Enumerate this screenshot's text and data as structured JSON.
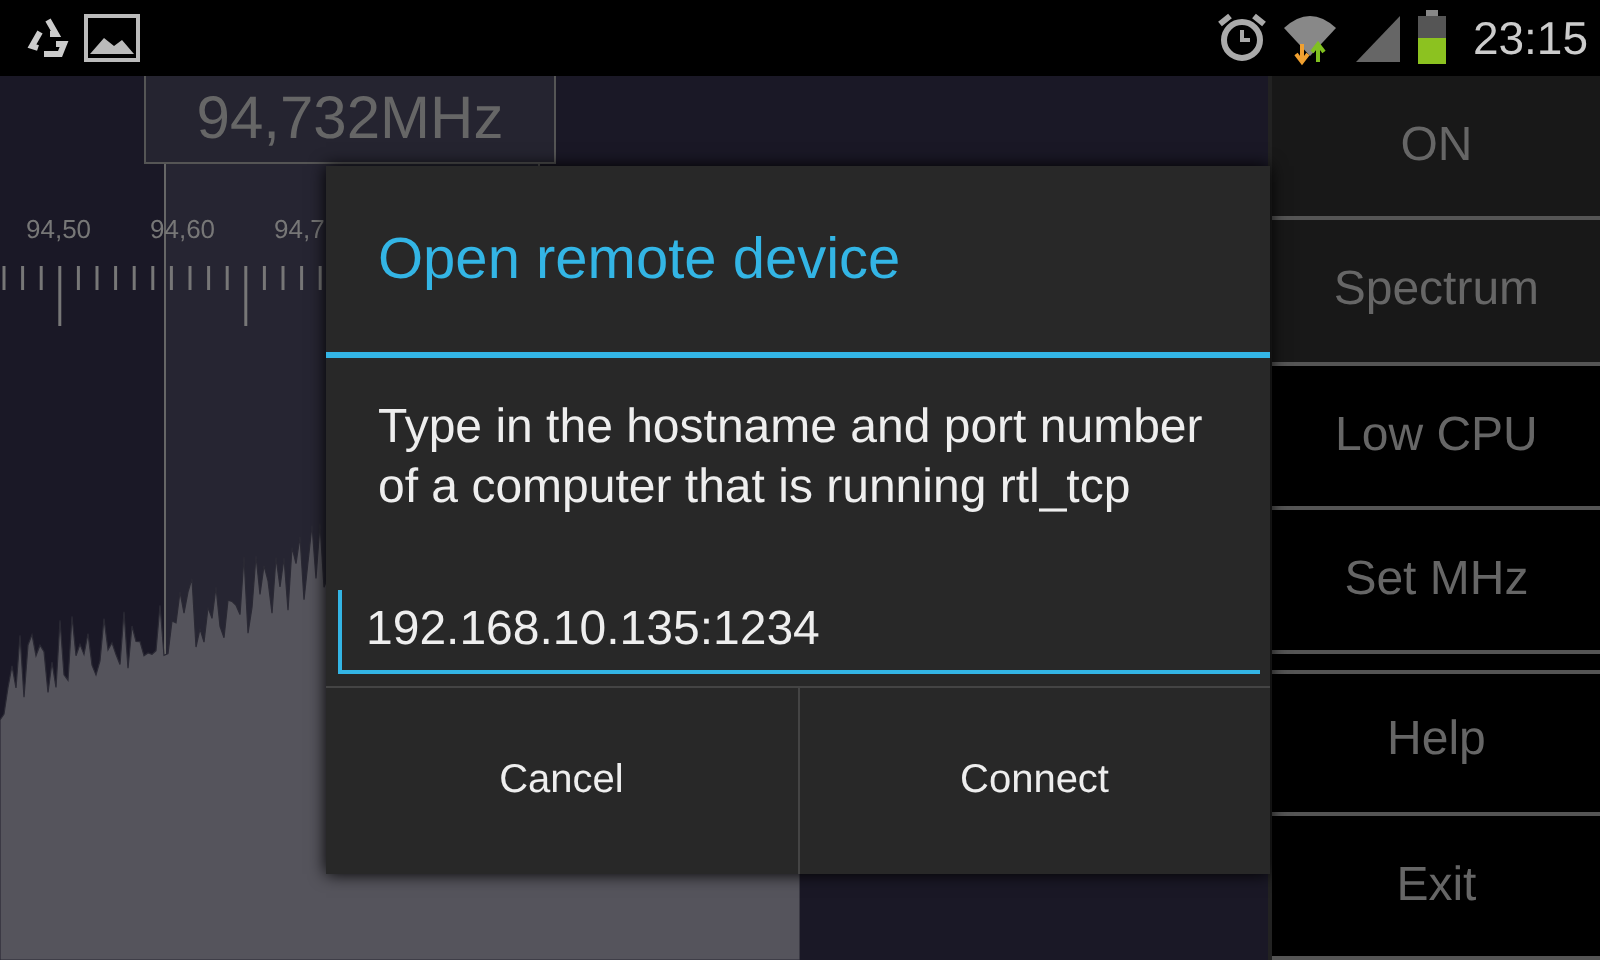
{
  "status_bar": {
    "time": "23:15"
  },
  "spectrum": {
    "frequency": "94,732MHz",
    "tick_labels": [
      "94,50",
      "94,60",
      "94,7"
    ]
  },
  "side_buttons": [
    {
      "label": "ON",
      "on": true
    },
    {
      "label": "Spectrum",
      "on": true
    },
    {
      "label": "Low CPU",
      "on": false
    },
    {
      "label": "Set MHz",
      "on": false
    },
    {
      "label": "Help",
      "on": false
    },
    {
      "label": "Exit",
      "on": false
    }
  ],
  "dialog": {
    "title": "Open remote device",
    "message": "Type in the hostname and port number of a computer that is running rtl_tcp",
    "input": {
      "value": "192.168.10.135:1234"
    },
    "buttons": [
      "Cancel",
      "Connect"
    ]
  }
}
